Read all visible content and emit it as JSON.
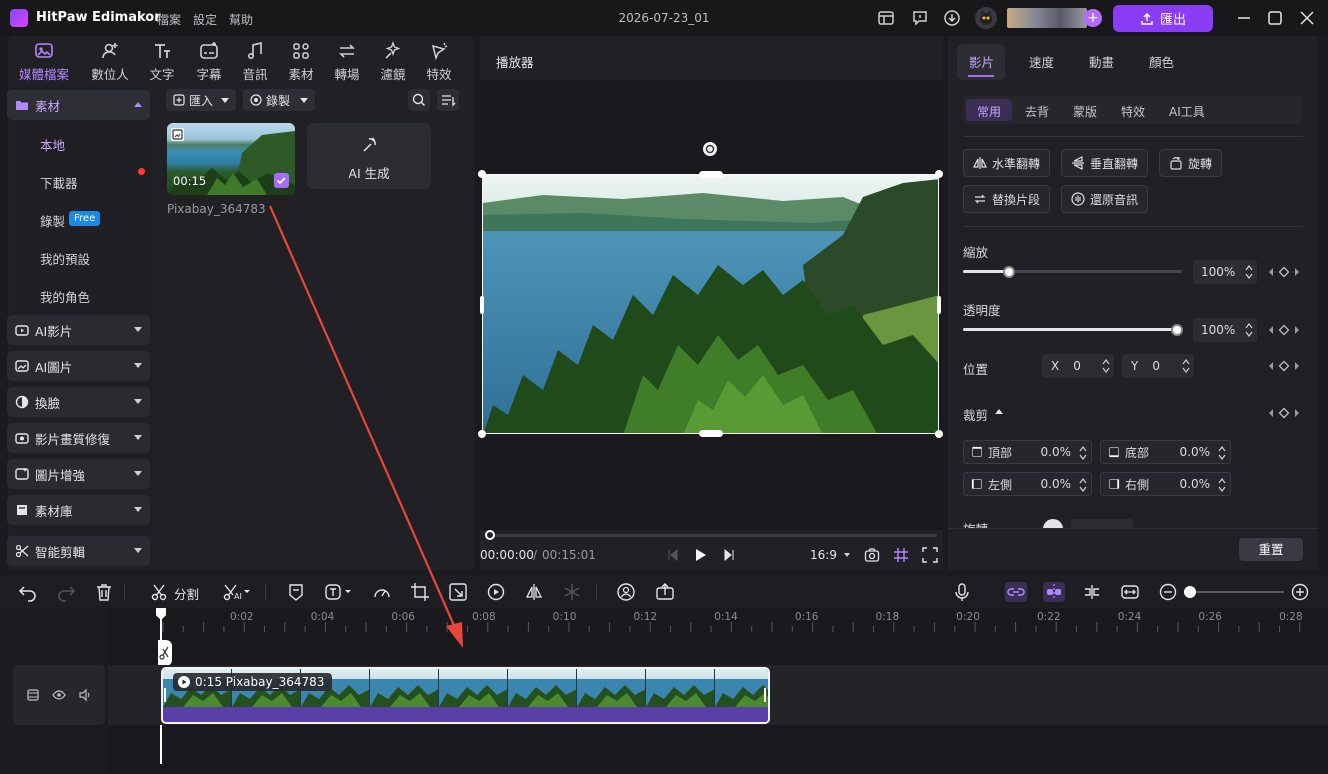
{
  "app": {
    "name": "HitPaw Edimakor",
    "menus": [
      "檔案",
      "設定",
      "幫助"
    ],
    "doc_title": "2026-07-23_01",
    "export_label": "匯出"
  },
  "media_tabs": [
    {
      "label": "媒體檔案",
      "icon": "media-icon",
      "active": true
    },
    {
      "label": "數位人",
      "icon": "avatar-add-icon"
    },
    {
      "label": "文字",
      "icon": "text-icon"
    },
    {
      "label": "字幕",
      "icon": "subtitle-icon"
    },
    {
      "label": "音訊",
      "icon": "music-icon"
    },
    {
      "label": "素材",
      "icon": "elements-icon"
    },
    {
      "label": "轉場",
      "icon": "transition-icon"
    },
    {
      "label": "濾鏡",
      "icon": "filter-icon"
    },
    {
      "label": "特效",
      "icon": "effects-icon"
    }
  ],
  "sidebar": {
    "material_label": "素材",
    "local": "本地",
    "downloader": "下載器",
    "record": "錄製",
    "free_badge": "Free",
    "presets": "我的預設",
    "roles": "我的角色",
    "groups": [
      "AI影片",
      "AI圖片",
      "換臉",
      "影片畫質修復",
      "圖片增強",
      "素材庫",
      "智能剪輯"
    ]
  },
  "library": {
    "import_label": "匯入",
    "record_label": "錄製",
    "clip_duration": "00:15",
    "clip_name": "Pixabay_364783",
    "ai_generate": "AI 生成"
  },
  "player": {
    "title": "播放器",
    "current_time": "00:00:00",
    "separator": "/",
    "total_time": "00:15:01",
    "aspect": "16:9"
  },
  "props": {
    "tabs": [
      "影片",
      "速度",
      "動畫",
      "顏色"
    ],
    "subtabs": [
      "常用",
      "去背",
      "蒙版",
      "特效",
      "AI工具"
    ],
    "buttons": [
      "水準翻轉",
      "垂直翻轉",
      "旋轉",
      "替換片段",
      "還原音訊"
    ],
    "scale_label": "縮放",
    "scale_value": "100%",
    "opacity_label": "透明度",
    "opacity_value": "100%",
    "position_label": "位置",
    "pos_x_label": "X",
    "pos_x": "0",
    "pos_y_label": "Y",
    "pos_y": "0",
    "crop_label": "裁剪",
    "crop_top_label": "頂部",
    "crop_top": "0.0%",
    "crop_bottom_label": "底部",
    "crop_bottom": "0.0%",
    "crop_left_label": "左側",
    "crop_left": "0.0%",
    "crop_right_label": "右側",
    "crop_right": "0.0%",
    "rotate_label": "旋轉",
    "reset_label": "重置"
  },
  "timeline": {
    "split_label": "分割",
    "ticks": [
      "0:02",
      "0:04",
      "0:06",
      "0:08",
      "0:10",
      "0:12",
      "0:14",
      "0:16",
      "0:18",
      "0:20",
      "0:22",
      "0:24",
      "0:26",
      "0:28"
    ],
    "clip_label": "0:15 Pixabay_364783"
  },
  "colors": {
    "accent": "#8b3cf7",
    "accent_text": "#b388ff",
    "audio_bar": "#5b3fa8",
    "badge_blue": "#1e88e5",
    "notify_red": "#ff3b30"
  }
}
